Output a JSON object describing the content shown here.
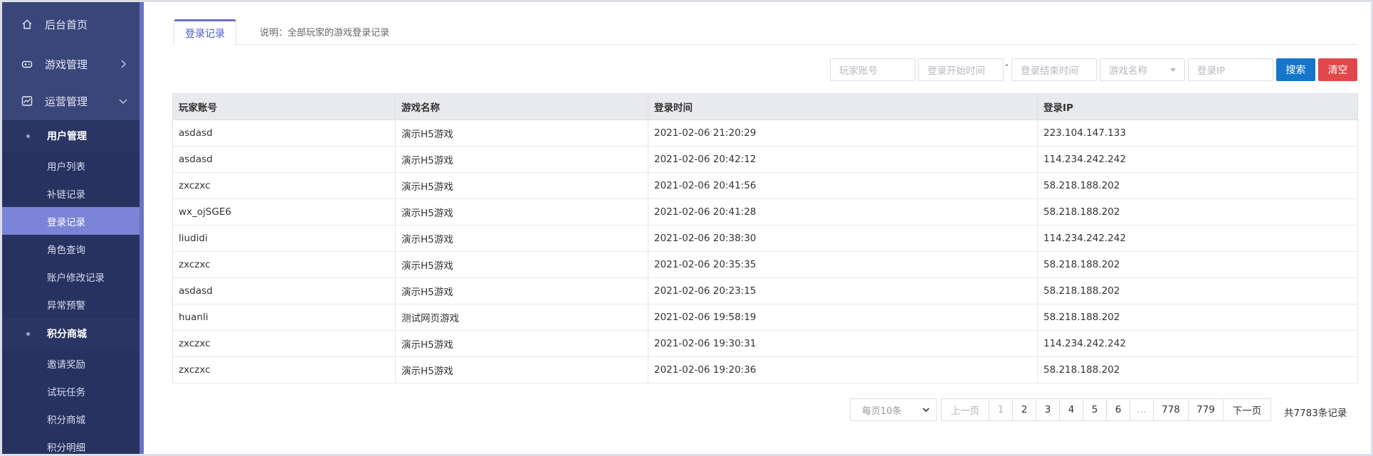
{
  "sidebar": {
    "top_items": [
      {
        "label": "后台首页",
        "icon": "home-icon"
      },
      {
        "label": "游戏管理",
        "icon": "gamepad-icon",
        "chevron": "right"
      },
      {
        "label": "运营管理",
        "icon": "chart-icon",
        "chevron": "down"
      }
    ],
    "groups": [
      {
        "label": "用户管理",
        "items": [
          "用户列表",
          "补链记录",
          "登录记录",
          "角色查询",
          "账户修改记录",
          "异常预警"
        ]
      },
      {
        "label": "积分商城",
        "items": [
          "邀请奖励",
          "试玩任务",
          "积分商城",
          "积分明细"
        ]
      }
    ],
    "active_item": "登录记录"
  },
  "tabs": {
    "active_label": "登录记录",
    "description": "说明：全部玩家的游戏登录记录"
  },
  "filters": {
    "account_placeholder": "玩家账号",
    "start_time_placeholder": "登录开始时间",
    "separator": "-",
    "end_time_placeholder": "登录结束时间",
    "game_name_placeholder": "游戏名称",
    "ip_placeholder": "登录IP",
    "search_label": "搜索",
    "clear_label": "清空"
  },
  "table": {
    "columns": [
      "玩家账号",
      "游戏名称",
      "登录时间",
      "登录IP"
    ],
    "rows": [
      [
        "asdasd",
        "演示H5游戏",
        "2021-02-06 21:20:29",
        "223.104.147.133"
      ],
      [
        "asdasd",
        "演示H5游戏",
        "2021-02-06 20:42:12",
        "114.234.242.242"
      ],
      [
        "zxczxc",
        "演示H5游戏",
        "2021-02-06 20:41:56",
        "58.218.188.202"
      ],
      [
        "wx_ojSGE6",
        "演示H5游戏",
        "2021-02-06 20:41:28",
        "58.218.188.202"
      ],
      [
        "liudidi",
        "演示H5游戏",
        "2021-02-06 20:38:30",
        "114.234.242.242"
      ],
      [
        "zxczxc",
        "演示H5游戏",
        "2021-02-06 20:35:35",
        "58.218.188.202"
      ],
      [
        "asdasd",
        "演示H5游戏",
        "2021-02-06 20:23:15",
        "58.218.188.202"
      ],
      [
        "huanli",
        "测试网页游戏",
        "2021-02-06 19:58:19",
        "58.218.188.202"
      ],
      [
        "zxczxc",
        "演示H5游戏",
        "2021-02-06 19:30:31",
        "114.234.242.242"
      ],
      [
        "zxczxc",
        "演示H5游戏",
        "2021-02-06 19:20:36",
        "58.218.188.202"
      ]
    ]
  },
  "pagination": {
    "page_size_label": "每页10条",
    "prev_label": "上一页",
    "pages": [
      "1",
      "2",
      "3",
      "4",
      "5",
      "6",
      "...",
      "778",
      "779"
    ],
    "next_label": "下一页",
    "total_label": "共7783条记录",
    "current_page": "1"
  }
}
